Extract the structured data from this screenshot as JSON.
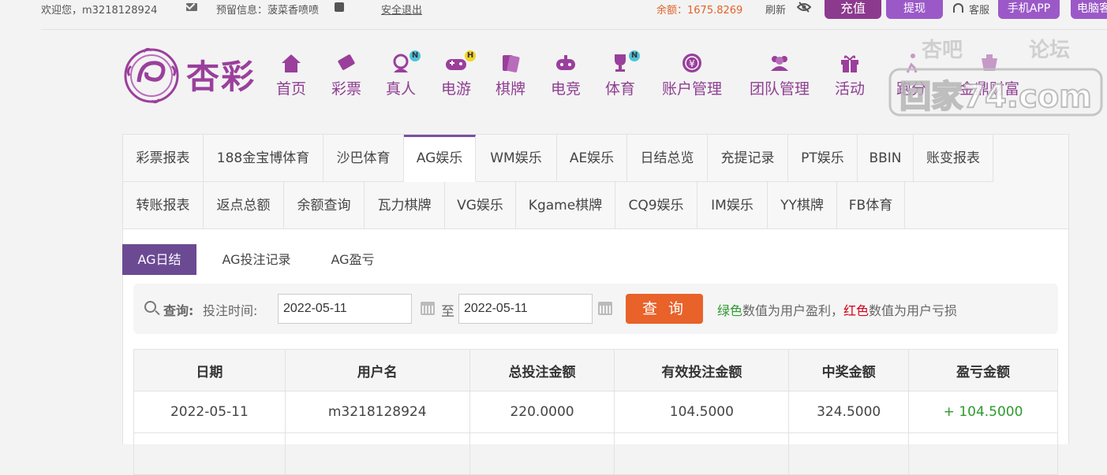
{
  "topbar": {
    "welcome": "欢迎您，m3218128924",
    "reserve": "预留信息：菠菜香喷喷",
    "logout": "安全退出",
    "balance": "余额：1675.8269",
    "refresh": "刷新",
    "recharge": "充值",
    "withdraw": "提现",
    "service": "客服",
    "app": "手机APP",
    "pc": "电脑客"
  },
  "logo": {
    "text": "杏彩"
  },
  "nav": [
    {
      "label": "首页",
      "icon": "home-icon",
      "badge": ""
    },
    {
      "label": "彩票",
      "icon": "lottery-icon",
      "badge": ""
    },
    {
      "label": "真人",
      "icon": "live-dealer-icon",
      "badge": "N"
    },
    {
      "label": "电游",
      "icon": "gamepad-icon",
      "badge": "H"
    },
    {
      "label": "棋牌",
      "icon": "cards-icon",
      "badge": ""
    },
    {
      "label": "电竞",
      "icon": "esports-icon",
      "badge": ""
    },
    {
      "label": "体育",
      "icon": "trophy-icon",
      "badge": "N"
    },
    {
      "label": "账户管理",
      "icon": "yen-coin-icon",
      "badge": ""
    },
    {
      "label": "团队管理",
      "icon": "team-icon",
      "badge": ""
    },
    {
      "label": "活动",
      "icon": "gift-icon",
      "badge": ""
    },
    {
      "label": "跑分",
      "icon": "run-icon",
      "badge": ""
    },
    {
      "label": "金鼎财富",
      "icon": "treasure-icon",
      "badge": ""
    }
  ],
  "watermark": {
    "line1": "杏吧",
    "line2": "论坛",
    "line3": "回家74.com"
  },
  "tabs_row1": [
    "彩票报表",
    "188金宝博体育",
    "沙巴体育",
    "AG娱乐",
    "WM娱乐",
    "AE娱乐",
    "日结总览",
    "充提记录",
    "PT娱乐",
    "BBIN",
    "账变报表"
  ],
  "tabs_row2": [
    "转账报表",
    "返点总额",
    "余额查询",
    "瓦力棋牌",
    "VG娱乐",
    "Kgame棋牌",
    "CQ9娱乐",
    "IM娱乐",
    "YY棋牌",
    "FB体育"
  ],
  "active_tab": "AG娱乐",
  "subtabs": [
    "AG日结",
    "AG投注记录",
    "AG盈亏"
  ],
  "query": {
    "label": "查询:",
    "time_label": "投注时间:",
    "start_date": "2022-05-11",
    "to": "至",
    "end_date": "2022-05-11",
    "button": "查 询",
    "legend_green": "绿色",
    "legend_mid": "数值为用户盈利，",
    "legend_red": "红色",
    "legend_end": "数值为用户亏损"
  },
  "table": {
    "headers": [
      "日期",
      "用户名",
      "总投注金额",
      "有效投注金额",
      "中奖金额",
      "盈亏金额"
    ],
    "rows": [
      [
        "2022-05-11",
        "m3218128924",
        "220.0000",
        "104.5000",
        "324.5000",
        "+ 104.5000"
      ],
      [
        "",
        "",
        "",
        "",
        "",
        ""
      ]
    ]
  },
  "colors": {
    "brand": "#8f3f92",
    "accent": "#e8622a",
    "win": "#2e9a2e",
    "loss": "#d0021b"
  }
}
